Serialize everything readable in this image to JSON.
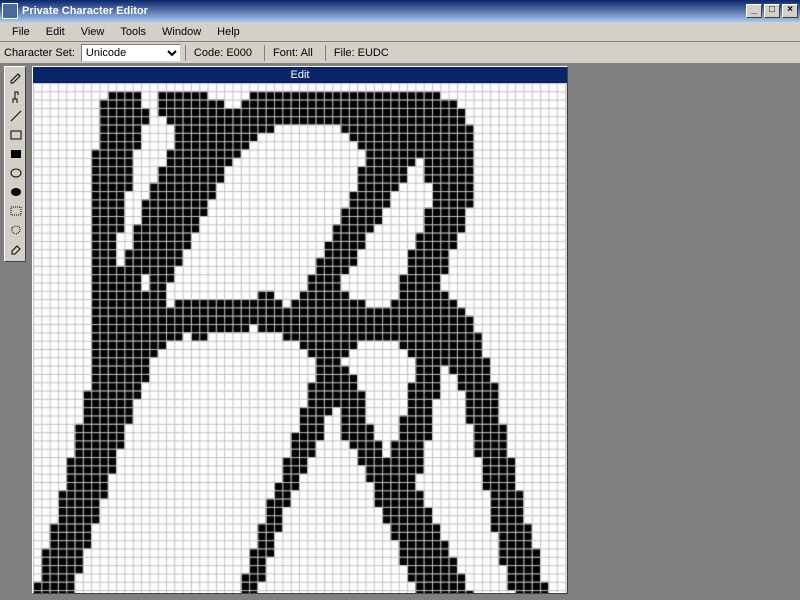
{
  "title": "Private Character Editor",
  "menu": [
    "File",
    "Edit",
    "View",
    "Tools",
    "Window",
    "Help"
  ],
  "infobar": {
    "charset_label": "Character Set:",
    "charset_value": "Unicode",
    "code_label": "Code:",
    "code_value": "E000",
    "font_label": "Font:",
    "font_value": "All",
    "file_label": "File:",
    "file_value": "EUDC"
  },
  "tools": [
    {
      "name": "pencil-tool",
      "title": "Pencil"
    },
    {
      "name": "brush-tool",
      "title": "Brush"
    },
    {
      "name": "line-tool",
      "title": "Straight Line"
    },
    {
      "name": "rect-tool",
      "title": "Hollow Rectangle"
    },
    {
      "name": "fillrect-tool",
      "title": "Filled Rectangle"
    },
    {
      "name": "ellipse-tool",
      "title": "Hollow Ellipse"
    },
    {
      "name": "fillellipse-tool",
      "title": "Filled Ellipse"
    },
    {
      "name": "rectselect-tool",
      "title": "Rectangular Selection"
    },
    {
      "name": "freeselect-tool",
      "title": "Freeform Selection"
    },
    {
      "name": "eraser-tool",
      "title": "Eraser"
    }
  ],
  "edit_panel": {
    "title": "Edit"
  },
  "grid": {
    "w": 64,
    "h": 64
  },
  "glyph_rows": [
    "0000000000000000000000000000000000000000000000000000000000000000",
    "0000000001111001111110000011111111111111111111111000000000000000",
    "0000000011111001111111100111111111111111111111111110000000000000",
    "0000000011111101111111111111111111111111111111111111000000000000",
    "0000000011111100111111111111111111111111111111111111000000000000",
    "0000000011111000011111111111100000000111111111111111100000000000",
    "0000000011111000011111111110000000000011111111111111100000000000",
    "0000000011111000011111111100000000000001111111111111100000000000",
    "0000000111110000111111111000000000000000111111111111100000000000",
    "0000000111110000111111110000000000000000111111011111100000000000",
    "0000000111110001111111100000000000000001111110011111100000000000",
    "0000000111110001111111100000000000000001111110011111100000000000",
    "0000000111110011111111000000000000000001111100001111100000000000",
    "0000000111100011111111000000000000000011111000001111100000000000",
    "0000000111100111111110000000000000000011111000001111100000000000",
    "0000000111100111111110000000000000000111110000011111000000000000",
    "0000000111100111111100000000000000000111110000011111000000000000",
    "0000000111101111111100000000000000001111100000011111000000000000",
    "0000000111001111111000000000000000001111000000111110000000000000",
    "0000000111001111111000000000000000011111000000111110000000000000",
    "0000000111011111110000000000000000011110000001111100000000000000",
    "0000000111011111110000000000000000111110000001111100000000000000",
    "0000000111111111100000000000000000111100000001111100000000000000",
    "0000000111111011100000000000000001111000000011111000000000000000",
    "0000000111111011000000000000000001111000000011111000000000000000",
    "0000000111111111000000000001100011111100000011111100000000000000",
    "0000000111111111011111111111110111111111000111111110000000000000",
    "0000000111111111111111111111111111111111111111111111000000000000",
    "0000000111111111111111111111111111111111111111111111100000000000",
    "0000000111111111111111111101111111111111111111111111100000000000",
    "0000000111111111110110000000001111111111111111111111110000000000",
    "0000000111111111000000000000000011111110000011111111110000000000",
    "0000000111111110000000000000000001111100000001111111110000000000",
    "0000000111111100000000000000000000111000000000111111111000000000",
    "0000000111111100000000000000000000111100000000111011111000000000",
    "0000000111111100000000000000000000111110000000111001111000000000",
    "0000000111111000000000000000000001111110000001111001111100000000",
    "0000001111111000000000000000000001111111000001111000111100000000",
    "0000001111110000000000000000000001111111000001110000111100000000",
    "0000001111110000000000000000000011110111000001110000111100000000",
    "0000001111110000000000000000000011100111000011110000111100000000",
    "0000011111100000000000000000000011100111100011110000011110000000",
    "0000011111100000000000000000000111100111100011110000011110000000",
    "0000011111100000000000000000000111000011110111100000011110000000",
    "0000011111000000000000000000000111000001110111100000011110000000",
    "0000111111000000000000000000001110000001111111100000001111000000",
    "0000111111000000000000000000001110000000111111100000001111000000",
    "0000111110000000000000000000001100000000111111000000001111000000",
    "0000111110000000000000000000011100000000011111000000001111000000",
    "0001111110000000000000000000011000000000011111100000000111100000",
    "0001111100000000000000000000111000000000011111100000000111100000",
    "0001111100000000000000000000110000000000001111110000000111100000",
    "0001111100000000000000000000110000000000001111110000000111100000",
    "0011111000000000000000000001110000000000000111111000000111110000",
    "0011111000000000000000000001100000000000000111111000000011110000",
    "0011111000000000000000000001100000000000000011111100000011110000",
    "0111110000000000000000000011100000000000000011111100000011111000",
    "0111110000000000000000000011000000000000000011111110000011111000",
    "0111110000000000000000000011000000000000000001111110000001111000",
    "0111100000000000000000000111000000000000000001111111000001111000",
    "1111100000000000000000000110000000000000000000111111000001111100",
    "1111100000000000000000000110000000000000000000111111100000111100",
    "1111000000000000000000001110000000000000000000111111100000111100",
    "1111000000000000000000001100000000000000000000011111110000111110"
  ]
}
